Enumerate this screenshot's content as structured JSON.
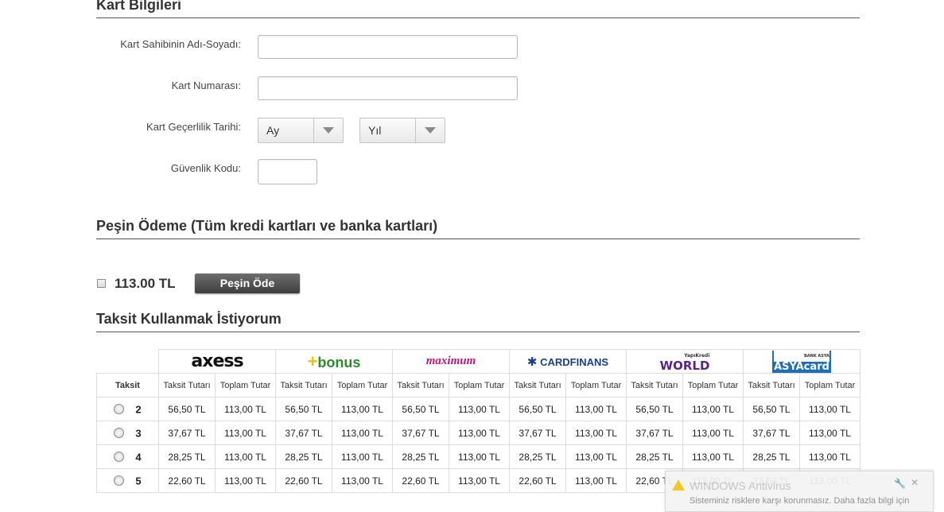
{
  "card_info": {
    "title": "Kart Bilgileri",
    "holder_label": "Kart Sahibinin Adı-Soyadı:",
    "holder_value": "",
    "number_label": "Kart Numarası:",
    "number_value": "",
    "expiry_label": "Kart Geçerlilik Tarihi:",
    "month_selected": "Ay",
    "year_selected": "Yıl",
    "cvv_label": "Güvenlik Kodu:",
    "cvv_value": ""
  },
  "cash_payment": {
    "title": "Peşin Ödeme (Tüm kredi kartları ve banka kartları)",
    "amount": "113.00 TL",
    "pay_button": "Peşin Öde"
  },
  "installments": {
    "title": "Taksit Kullanmak İstiyorum",
    "taksit_header": "Taksit",
    "col_installment": "Taksit Tutarı",
    "col_total": "Toplam Tutar",
    "cards": [
      {
        "name": "axess",
        "logo_text": "axess",
        "icon": "axess-logo"
      },
      {
        "name": "bonus",
        "logo_text": "bonus",
        "icon": "bonus-logo"
      },
      {
        "name": "maximum",
        "logo_text": "maximum",
        "icon": "maximum-logo"
      },
      {
        "name": "cardfinans",
        "logo_text": "CARDFINANS",
        "icon": "cardfinans-logo"
      },
      {
        "name": "world",
        "logo_text": "WORLD",
        "logo_sub": "YapıKredi",
        "icon": "world-logo"
      },
      {
        "name": "asyacard",
        "logo_text": "ASYAcard",
        "logo_sub": "BANK ASYA",
        "icon": "asyacard-logo"
      }
    ],
    "rows": [
      {
        "count": "2",
        "installment": "56,50 TL",
        "total": "113,00 TL"
      },
      {
        "count": "3",
        "installment": "37,67 TL",
        "total": "113,00 TL"
      },
      {
        "count": "4",
        "installment": "28,25 TL",
        "total": "113,00 TL"
      },
      {
        "count": "5",
        "installment": "22,60 TL",
        "total": "113,00 TL"
      }
    ]
  },
  "antivirus_popup": {
    "title": "WINDOWS Antivirus",
    "text": "Sisteminiz risklere karşı korunmasız. Daha fazla bilgi için"
  }
}
